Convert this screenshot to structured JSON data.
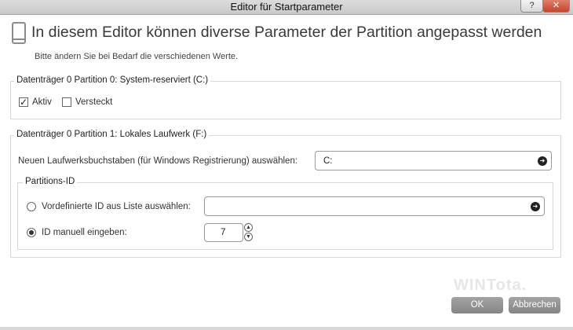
{
  "window": {
    "title": "Editor für Startparameter",
    "help_label": "?",
    "close_label": "✕"
  },
  "header": {
    "heading": "In diesem Editor können diverse Parameter der Partition angepasst werden",
    "subheading": "Bitte ändern Sie bei Bedarf die verschiedenen Werte."
  },
  "partition0": {
    "title": "Datenträger 0 Partition 0: System-reserviert (C:)",
    "aktiv_label": "Aktiv",
    "aktiv_checked": true,
    "versteckt_label": "Versteckt",
    "versteckt_checked": false
  },
  "partition1": {
    "title": "Datenträger 0 Partition 1: Lokales Laufwerk (F:)",
    "drive_letter_label": "Neuen Laufwerksbuchstaben (für Windows Registrierung) auswählen:",
    "drive_letter_value": "C:",
    "partition_id": {
      "title": "Partitions-ID",
      "predefined_label": "Vordefinierte ID aus Liste auswählen:",
      "predefined_value": "",
      "manual_label": "ID manuell eingeben:",
      "manual_value": "7",
      "selected": "manual"
    }
  },
  "footer": {
    "ok_label": "OK",
    "cancel_label": "Abbrechen",
    "watermark": "WINTota."
  },
  "icons": {
    "checkmark": "✓",
    "go": "➜",
    "spin_up": "▲",
    "spin_down": "▼"
  },
  "colors": {
    "button": "#959595",
    "close": "#c7432a"
  }
}
